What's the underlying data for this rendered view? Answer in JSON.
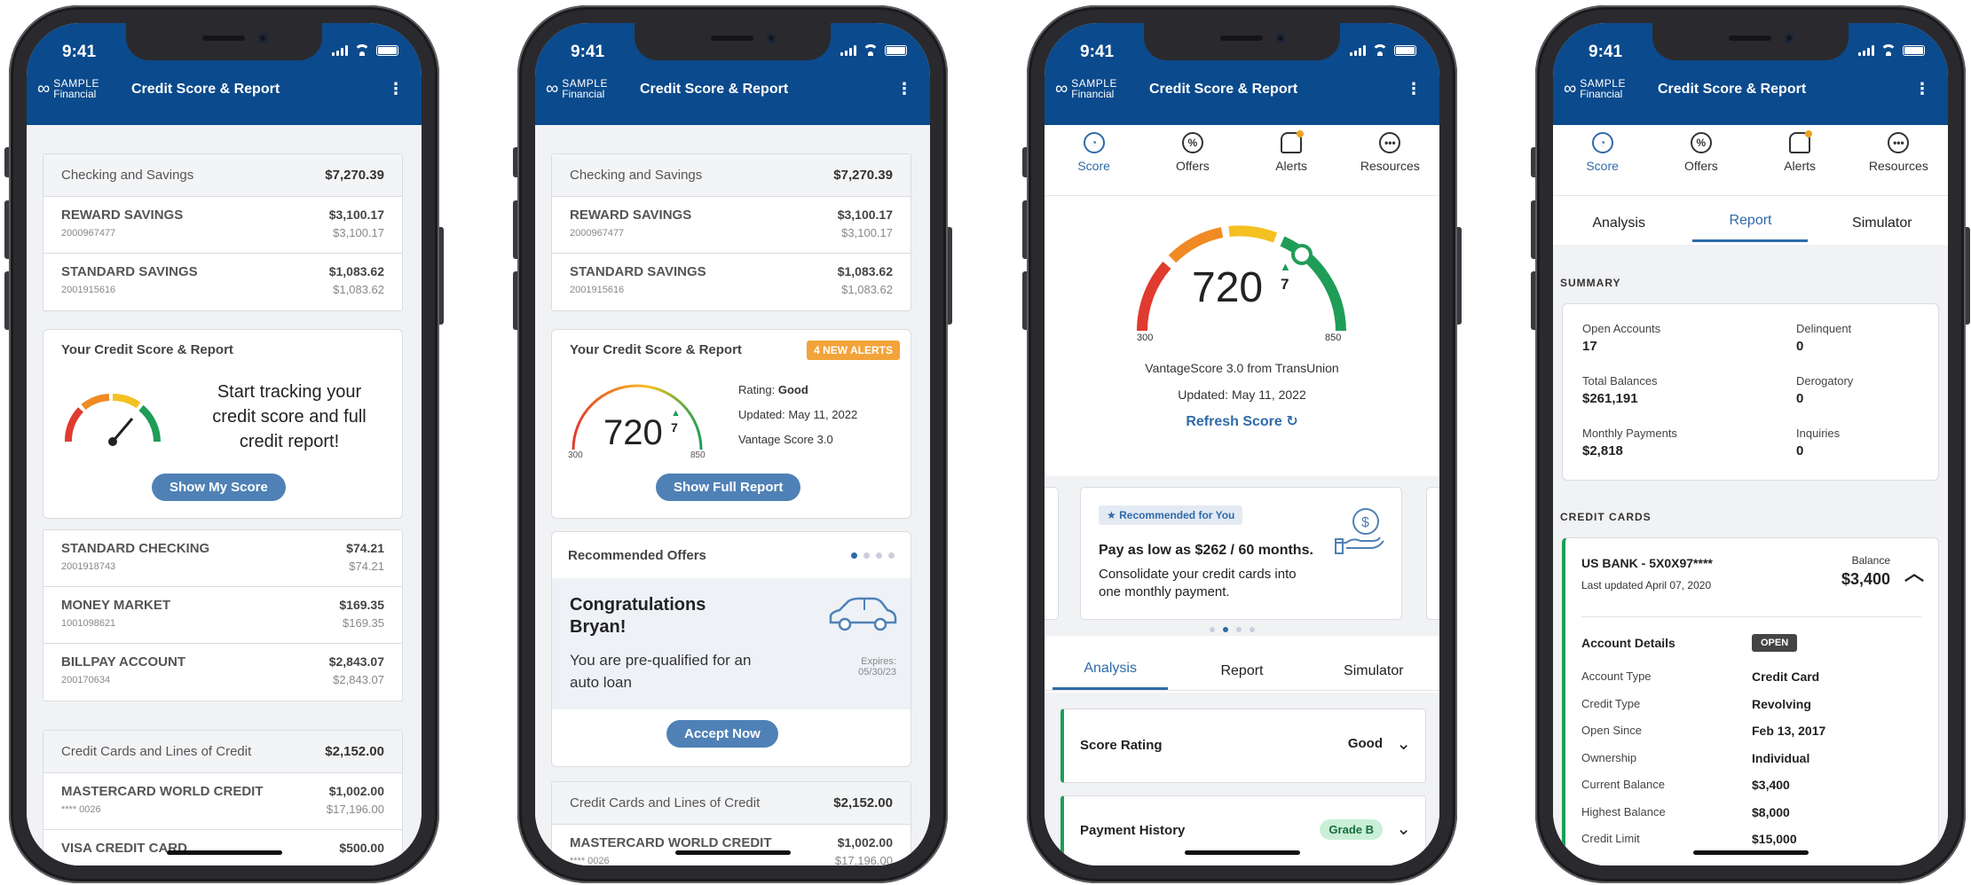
{
  "status": {
    "time": "9:41"
  },
  "header": {
    "brand_line1": "SAMPLE",
    "brand_line2": "Financial",
    "title": "Credit Score & Report"
  },
  "checking_savings": {
    "label": "Checking and Savings",
    "total": "$7,270.39",
    "accounts": [
      {
        "name": "REWARD SAVINGS",
        "number": "2000967477",
        "balance": "$3,100.17",
        "available": "$3,100.17"
      },
      {
        "name": "STANDARD SAVINGS",
        "number": "2001915616",
        "balance": "$1,083.62",
        "available": "$1,083.62"
      }
    ]
  },
  "other_accounts": [
    {
      "name": "STANDARD CHECKING",
      "number": "2001918743",
      "balance": "$74.21",
      "available": "$74.21"
    },
    {
      "name": "MONEY MARKET",
      "number": "1001098621",
      "balance": "$169.35",
      "available": "$169.35"
    },
    {
      "name": "BILLPAY ACCOUNT",
      "number": "200170634",
      "balance": "$2,843.07",
      "available": "$2,843.07"
    }
  ],
  "credit_cards": {
    "label": "Credit Cards and Lines of Credit",
    "total": "$2,152.00",
    "accounts": [
      {
        "name": "MASTERCARD WORLD CREDIT",
        "number": "**** 0026",
        "balance": "$1,002.00",
        "available": "$17,196.00"
      },
      {
        "name": "VISA CREDIT CARD",
        "number": "",
        "balance": "$500.00",
        "available": ""
      }
    ]
  },
  "credit_promo": {
    "title": "Your Credit Score & Report",
    "message": "Start tracking your credit score and full credit report!",
    "button": "Show My Score"
  },
  "credit_summary": {
    "title": "Your Credit Score & Report",
    "alerts_badge": "4 NEW ALERTS",
    "score": "720",
    "change": "7",
    "min": "300",
    "max": "850",
    "rating_label": "Rating:",
    "rating": "Good",
    "updated": "Updated: May 11, 2022",
    "model": "Vantage Score 3.0",
    "button": "Show Full Report"
  },
  "offers": {
    "title": "Recommended Offers",
    "headline": "Congratulations Bryan!",
    "text": "You are pre-qualified for an auto loan",
    "expires_label": "Expires:",
    "expires": "05/30/23",
    "button": "Accept Now"
  },
  "nav_tabs": [
    {
      "label": "Score",
      "icon": "speedometer-icon"
    },
    {
      "label": "Offers",
      "icon": "percent-icon"
    },
    {
      "label": "Alerts",
      "icon": "bell-icon"
    },
    {
      "label": "Resources",
      "icon": "more-icon"
    }
  ],
  "score_detail": {
    "score": "720",
    "change": "7",
    "min": "300",
    "max": "850",
    "source": "VantageScore 3.0 from TransUnion",
    "updated": "Updated: May 11, 2022",
    "refresh": "Refresh Score"
  },
  "recommended": {
    "badge": "Recommended for You",
    "headline_prefix": "Pay as low as ",
    "headline_amount": "$262 / 60 months.",
    "text": "Consolidate your credit cards into one monthly payment."
  },
  "sub_tabs": [
    "Analysis",
    "Report",
    "Simulator"
  ],
  "analysis_rows": [
    {
      "label": "Score Rating",
      "value": "Good"
    },
    {
      "label": "Payment History",
      "value": "Grade B"
    }
  ],
  "report": {
    "summary_title": "SUMMARY",
    "summary": [
      {
        "label": "Open Accounts",
        "value": "17"
      },
      {
        "label": "Delinquent",
        "value": "0"
      },
      {
        "label": "Total Balances",
        "value": "$261,191"
      },
      {
        "label": "Derogatory",
        "value": "0"
      },
      {
        "label": "Monthly Payments",
        "value": "$2,818"
      },
      {
        "label": "Inquiries",
        "value": "0"
      }
    ],
    "cards_title": "CREDIT CARDS",
    "card": {
      "name": "US BANK - 5X0X97****",
      "updated": "Last updated April 07, 2020",
      "balance_label": "Balance",
      "balance": "$3,400",
      "details_title": "Account Details",
      "status": "OPEN",
      "details": [
        {
          "label": "Account Type",
          "value": "Credit Card"
        },
        {
          "label": "Credit Type",
          "value": "Revolving"
        },
        {
          "label": "Open Since",
          "value": "Feb 13, 2017"
        },
        {
          "label": "Ownership",
          "value": "Individual"
        },
        {
          "label": "Current Balance",
          "value": "$3,400"
        },
        {
          "label": "Highest Balance",
          "value": "$8,000"
        },
        {
          "label": "Credit Limit",
          "value": "$15,000"
        }
      ]
    }
  },
  "colors": {
    "header": "#0b4a8c",
    "accent": "#2f6aa9",
    "button": "#4f81b6",
    "alert": "#f0a020",
    "good": "#1f9d57"
  }
}
